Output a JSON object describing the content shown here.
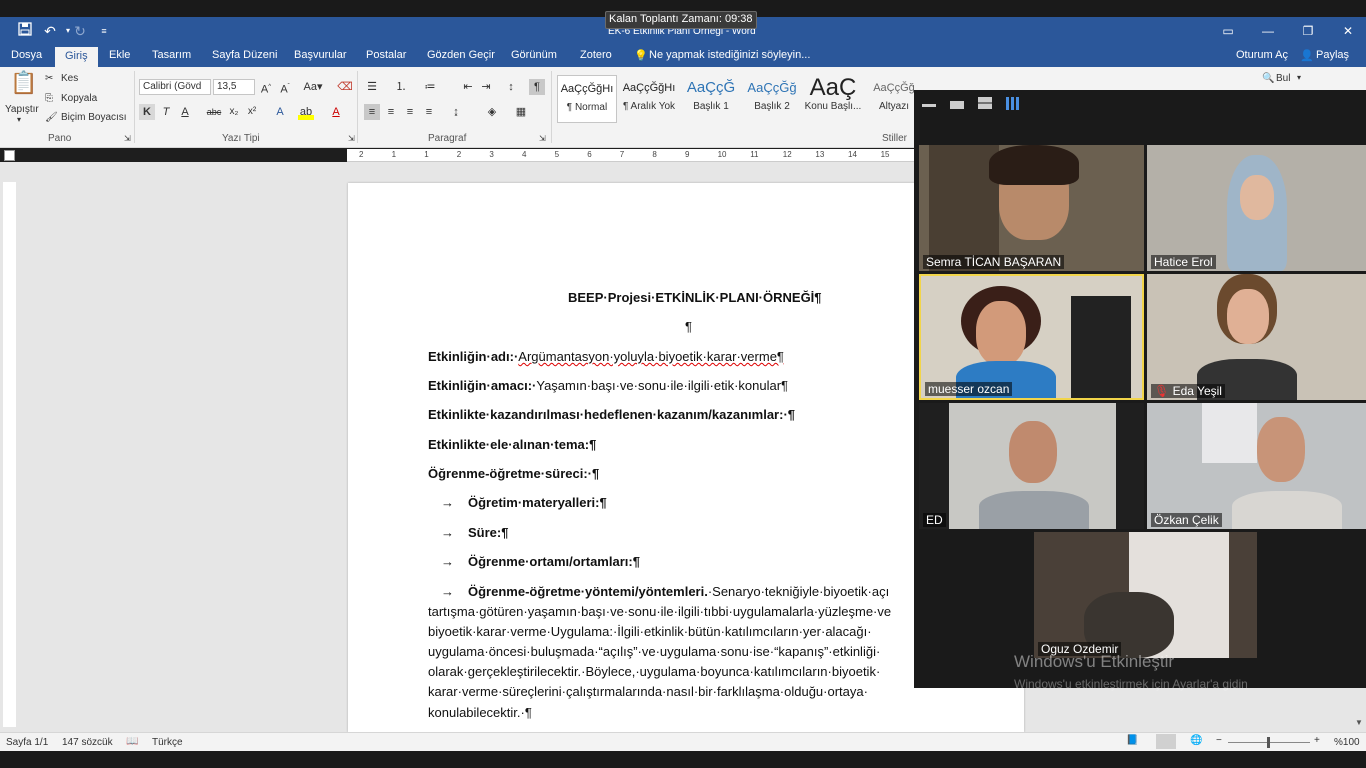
{
  "window": {
    "doc_title": "EK-6 Etkinlik Planı Örneği - Word",
    "meeting_timer": "Kalan Toplantı Zamanı: 09:38"
  },
  "tabs": [
    "Dosya",
    "Giriş",
    "Ekle",
    "Tasarım",
    "Sayfa Düzeni",
    "Başvurular",
    "Postalar",
    "Gözden Geçir",
    "Görünüm",
    "Zotero"
  ],
  "tell_me": "Ne yapmak istediğinizi söyleyin...",
  "account": {
    "sign_in": "Oturum Aç",
    "share": "Paylaş"
  },
  "ribbon": {
    "clipboard": {
      "paste": "Yapıştır",
      "cut": "Kes",
      "copy": "Kopyala",
      "format_painter": "Biçim Boyacısı",
      "label": "Pano"
    },
    "font": {
      "name": "Calibri (Gövd",
      "size": "13,5",
      "label": "Yazı Tipi"
    },
    "paragraph": {
      "label": "Paragraf"
    },
    "styles": {
      "label": "Stiller",
      "items": [
        {
          "sample": "AaÇçĞğHı",
          "name": "¶ Normal"
        },
        {
          "sample": "AaÇçĞğHı",
          "name": "¶ Aralık Yok"
        },
        {
          "sample": "AaÇçĞ",
          "name": "Başlık 1"
        },
        {
          "sample": "AaÇçĞğ",
          "name": "Başlık 2"
        },
        {
          "sample": "AaÇ",
          "name": "Konu Başlı..."
        },
        {
          "sample": "AaÇçĞğ",
          "name": "Altyazı"
        }
      ]
    },
    "find": "Bul"
  },
  "ruler_numbers": [
    "2",
    "1",
    "1",
    "2",
    "3",
    "4",
    "5",
    "6",
    "7",
    "8",
    "9",
    "10",
    "11",
    "12",
    "13",
    "14",
    "15"
  ],
  "document": {
    "title": "BEEP·Projesi·ETKİNLİK·PLANI·ÖRNEĞİ¶",
    "empty_para": "¶",
    "lines": [
      {
        "label": "Etkinliğin·adı:·",
        "value": "Argümantasyon·yoluyla·biyoetik·karar·verme¶"
      },
      {
        "label": "Etkinliğin·amacı:·",
        "value": "Yaşamın·başı·ve·sonu·ile·ilgili·etik·konular¶"
      },
      {
        "label": "Etkinlikte·kazandırılması·hedeflenen·kazanım/kazanımlar:·¶",
        "value": ""
      },
      {
        "label": "Etkinlikte·ele·alınan·tema:¶",
        "value": ""
      },
      {
        "label": "Öğrenme-öğretme·süreci:·¶",
        "value": ""
      }
    ],
    "bullets": [
      "Öğretim·materyalleri:¶",
      "Süre:¶",
      "Öğrenme·ortamı/ortamları:¶"
    ],
    "method_label": "Öğrenme-öğretme·yöntemi/yöntemleri.",
    "method_text": [
      "·Senaryo·tekniğiyle·biyoetik·açı",
      "tartışma·götüren·yaşamın·başı·ve·sonu·ile·ilgili·tıbbi·uygulamalarla·yüzleşme·ve",
      "biyoetik·karar·verme·Uygulama:·İlgili·etkinlik·bütün·katılımcıların·yer·alacağı·",
      "uygulama·öncesi·buluşmada·“açılış”·ve·uygulama·sonu·ise·“kapanış”·etkinliği·",
      "olarak·gerçekleştirilecektir.·Böylece,·uygulama·boyunca·katılımcıların·biyoetik·",
      "karar·verme·süreçlerini·çalıştırmalarında·nasıl·bir·farklılaşma·olduğu·ortaya·",
      "konulabilecektir.·¶"
    ]
  },
  "status": {
    "page": "Sayfa 1/1",
    "words": "147 sözcük",
    "language": "Türkçe",
    "zoom": "%100"
  },
  "zoom_meeting": {
    "participants": [
      {
        "name": "Semra TİCAN BAŞARAN"
      },
      {
        "name": "Hatice Erol"
      },
      {
        "name": "muesser ozcan",
        "active": true
      },
      {
        "name": "Eda Yeşil",
        "muted": true
      },
      {
        "name": "ED"
      },
      {
        "name": "Özkan Çelik"
      },
      {
        "name": "Oguz Ozdemir"
      }
    ]
  },
  "watermark": {
    "title": "Windows'u Etkinleştir",
    "subtitle": "Windows'u etkinleştirmek için Ayarlar'a gidin"
  }
}
